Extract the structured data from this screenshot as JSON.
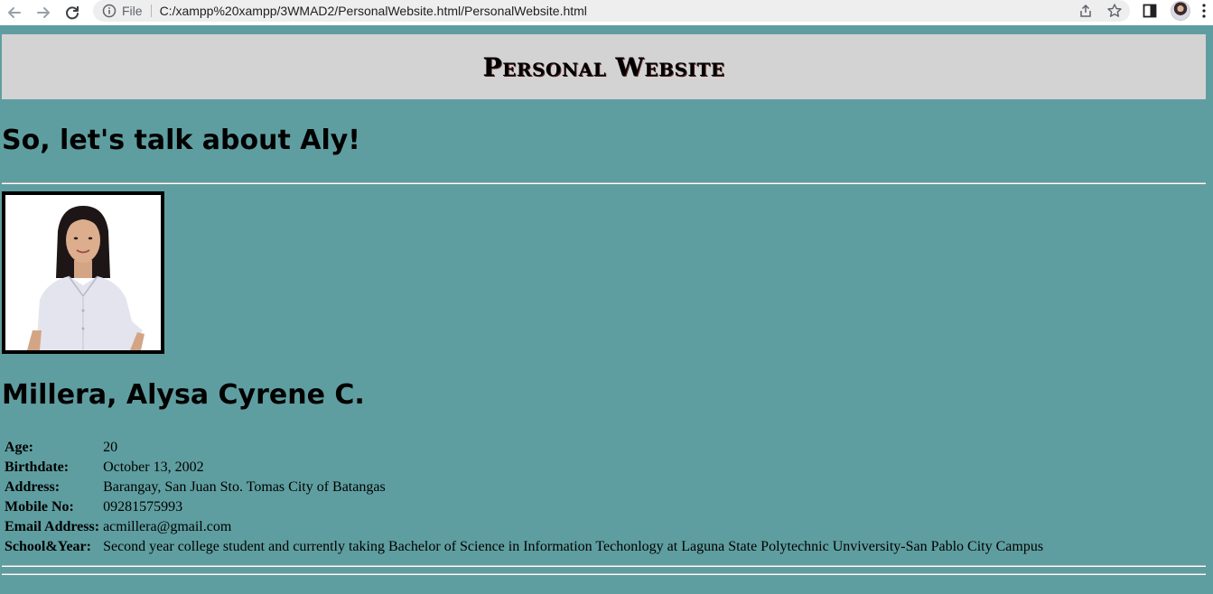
{
  "browser": {
    "file_label": "File",
    "url": "C:/xampp%20xampp/3WMAD2/PersonalWebsite.html/PersonalWebsite.html"
  },
  "page": {
    "site_title": "Personal Website",
    "intro_heading": "So, let's talk about Aly!",
    "name": "Millera, Alysa Cyrene C."
  },
  "profile": [
    {
      "label": "Age:",
      "value": "20"
    },
    {
      "label": "Birthdate:",
      "value": "October 13, 2002"
    },
    {
      "label": "Address:",
      "value": "Barangay, San Juan Sto. Tomas City of Batangas"
    },
    {
      "label": "Mobile No:",
      "value": "09281575993"
    },
    {
      "label": "Email Address:",
      "value": "acmillera@gmail.com"
    },
    {
      "label": "School&Year:",
      "value": "Second year college student and currently taking Bachelor of Science in Information Techonlogy at Laguna State Polytechnic Unviversity-San Pablo City Campus"
    }
  ],
  "colors": {
    "page_background": "#5f9ea0",
    "header_background": "#d3d3d3"
  }
}
